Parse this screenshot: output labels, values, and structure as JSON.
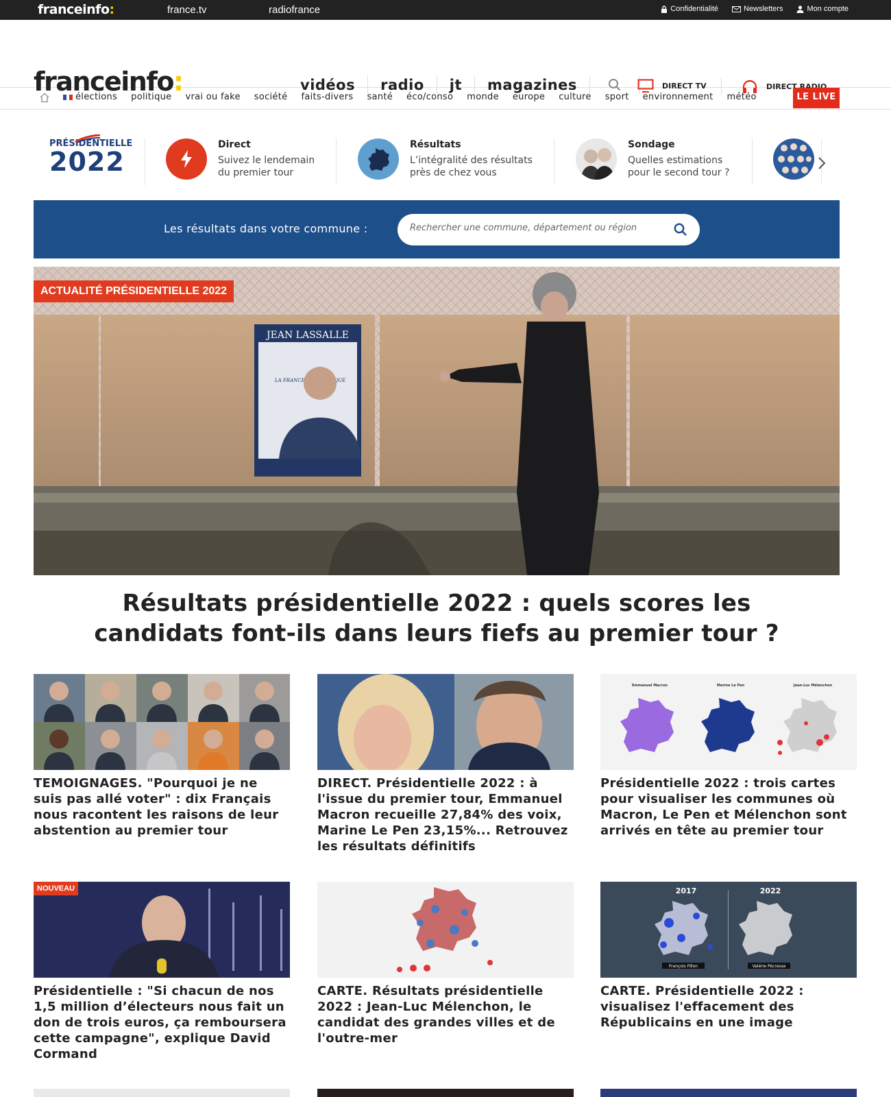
{
  "topbar": {
    "brand": "franceinfo",
    "brand_colon": ":",
    "link1": "france.tv",
    "link2": "radiofrance",
    "privacy": "Confidentialité",
    "newsletters": "Newsletters",
    "account": "Mon compte"
  },
  "header": {
    "logo": "franceinfo",
    "logo_colon": ":",
    "nav": [
      "vidéos",
      "radio",
      "jt",
      "magazines"
    ],
    "direct_tv": "DIRECT TV",
    "direct_radio": "DIRECT RADIO"
  },
  "subnav": {
    "items": [
      "élections",
      "politique",
      "vrai ou fake",
      "société",
      "faits-divers",
      "santé",
      "éco/conso",
      "monde",
      "europe",
      "culture",
      "sport",
      "environnement",
      "météo"
    ],
    "live": "LE LIVE"
  },
  "presidentielle": {
    "logo_top": "PRÉSIDENTIELLE",
    "logo_year": "2022",
    "items": [
      {
        "title": "Direct",
        "desc1": "Suivez le lendemain",
        "desc2": "du premier tour"
      },
      {
        "title": "Résultats",
        "desc1": "L’intégralité des résultats",
        "desc2": "près de chez vous"
      },
      {
        "title": "Sondage",
        "desc1": "Quelles estimations",
        "desc2": "pour le second tour ?"
      }
    ]
  },
  "results_search": {
    "label": "Les résultats dans votre commune :",
    "placeholder": "Rechercher une commune, département ou région"
  },
  "hero": {
    "tag": "ACTUALITÉ PRÉSIDENTIELLE 2022",
    "poster_name": "JEAN LASSALLE",
    "poster_slogan": "LA FRANCE AUTHENTIQUE",
    "title_line1": "Résultats présidentielle 2022 : quels scores les",
    "title_line2": "candidats font-ils dans leurs fiefs au premier tour ?"
  },
  "cards": [
    {
      "title": "TEMOIGNAGES. \"Pourquoi je ne suis pas allé voter\" : dix Français nous racontent les raisons de leur abstention au premier tour"
    },
    {
      "title": "DIRECT. Présidentielle 2022 : à l'issue du premier tour, Emmanuel Macron recueille 27,84% des voix, Marine Le Pen 23,15%... Retrouvez les résultats définitifs"
    },
    {
      "title": "Présidentielle 2022 : trois cartes pour visualiser les communes où Macron, Le Pen et Mélenchon sont arrivés en tête au premier tour",
      "map_labels": [
        "Emmanuel Macron",
        "Marine Le Pen",
        "Jean-Luc Mélenchon"
      ]
    },
    {
      "badge": "NOUVEAU",
      "title": "Présidentielle : \"Si chacun de nos 1,5 million d’électeurs nous fait un don de trois euros, ça remboursera cette campagne\", explique David Cormand"
    },
    {
      "title": "CARTE. Résultats présidentielle 2022 : Jean-Luc Mélenchon, le candidat des grandes villes et de l'outre-mer"
    },
    {
      "title": "CARTE. Présidentielle 2022 : visualisez l'effacement des Républicains en une image",
      "year1": "2017",
      "year2": "2022",
      "cap1": "François Fillon",
      "cap2": "Valérie Pécresse"
    }
  ],
  "colors": {
    "accent_yellow": "#fecc00",
    "live_red": "#e22b18",
    "band_blue": "#1d4f8b",
    "tag_red": "#e03b1f"
  }
}
